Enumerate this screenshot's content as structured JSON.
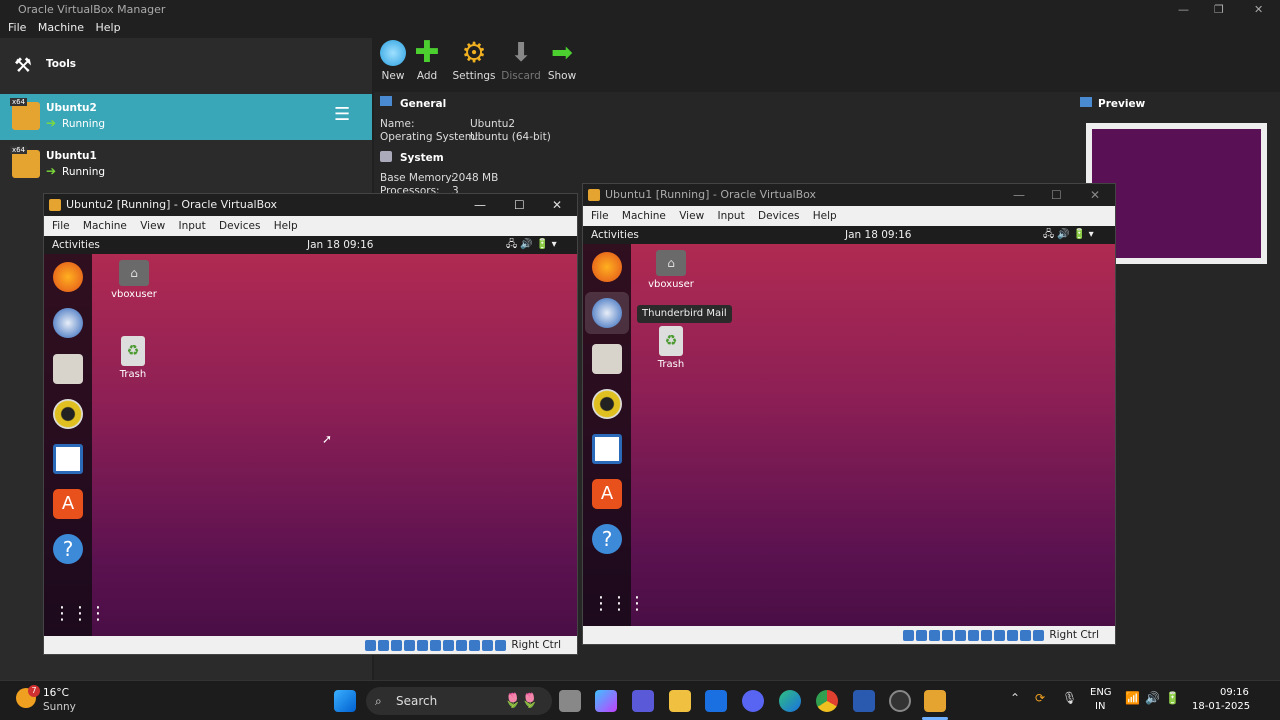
{
  "manager": {
    "title": "Oracle VirtualBox Manager",
    "menu": [
      "File",
      "Machine",
      "Help"
    ],
    "tools_label": "Tools",
    "toolbar": {
      "new": "New",
      "add": "Add",
      "settings": "Settings",
      "discard": "Discard",
      "show": "Show"
    },
    "vms": [
      {
        "name": "Ubuntu2",
        "state": "Running"
      },
      {
        "name": "Ubuntu1",
        "state": "Running"
      }
    ],
    "general": {
      "heading": "General",
      "name_label": "Name:",
      "name_value": "Ubuntu2",
      "os_label": "Operating System:",
      "os_value": "Ubuntu (64-bit)"
    },
    "system": {
      "heading": "System",
      "mem_label": "Base Memory:",
      "mem_value": "2048 MB",
      "proc_label": "Processors:",
      "proc_value": "3"
    },
    "preview_heading": "Preview"
  },
  "vm2": {
    "title": "Ubuntu2 [Running] - Oracle VirtualBox",
    "menu": [
      "File",
      "Machine",
      "View",
      "Input",
      "Devices",
      "Help"
    ],
    "activities": "Activities",
    "clock": "Jan 18  09:16",
    "icons": {
      "home": "vboxuser",
      "trash": "Trash"
    },
    "host_key": "Right Ctrl"
  },
  "vm1": {
    "title": "Ubuntu1 [Running] - Oracle VirtualBox",
    "menu": [
      "File",
      "Machine",
      "View",
      "Input",
      "Devices",
      "Help"
    ],
    "activities": "Activities",
    "clock": "Jan 18  09:16",
    "icons": {
      "home": "vboxuser",
      "trash": "Trash"
    },
    "tooltip": "Thunderbird Mail",
    "host_key": "Right Ctrl"
  },
  "taskbar": {
    "weather_temp": "16°C",
    "weather_desc": "Sunny",
    "weather_badge": "7",
    "search": "Search",
    "lang1": "ENG",
    "lang2": "IN",
    "time": "09:16",
    "date": "18-01-2025"
  }
}
